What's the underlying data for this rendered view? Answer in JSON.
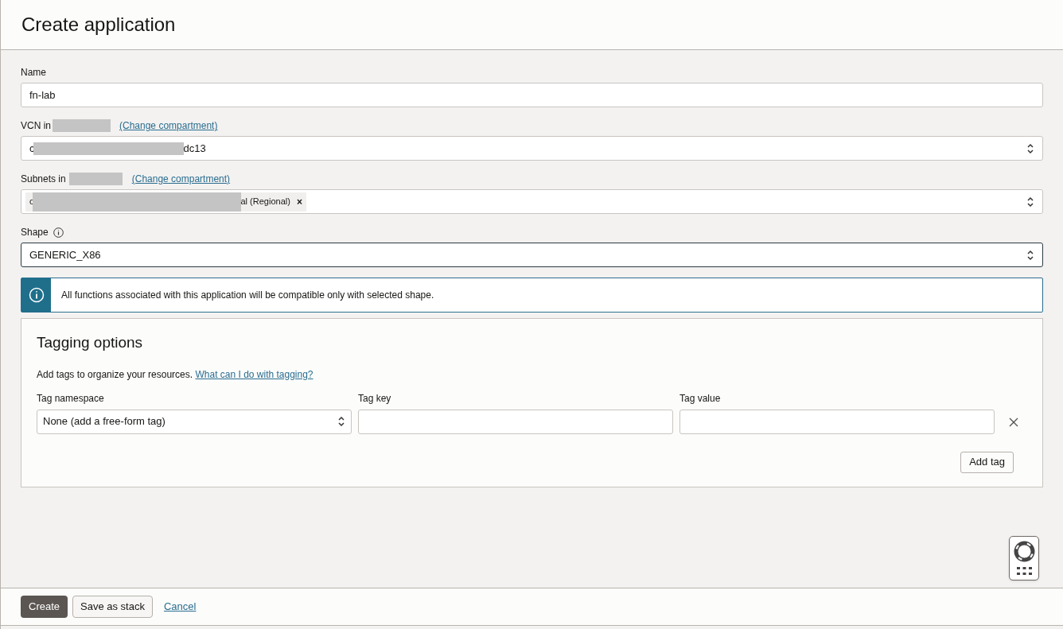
{
  "title": "Create application",
  "name_field": {
    "label": "Name",
    "value": "fn-lab"
  },
  "vcn_field": {
    "label": "VCN in",
    "link": "(Change compartment)",
    "value_start": "c",
    "value_end": "dc13",
    "redacted": true
  },
  "subnets_field": {
    "label": "Subnets in",
    "link": "(Change compartment)",
    "chip_start": "c",
    "chip_end": "al (Regional)",
    "chip_remove": "×",
    "redacted": true
  },
  "shape_field": {
    "label": "Shape",
    "value": "GENERIC_X86",
    "focused": true
  },
  "info_banner": {
    "text": "All functions associated with this application will be compatible only with selected shape."
  },
  "tagging": {
    "title": "Tagging options",
    "description": "Add tags to organize your resources.",
    "link": "What can I do with tagging?",
    "columns": [
      "Tag namespace",
      "Tag key",
      "Tag value"
    ],
    "namespace_value": "None (add a free-form tag)",
    "add_button": "Add tag"
  },
  "footer": {
    "buttons": [
      {
        "label": "Create",
        "kind": "primary"
      },
      {
        "label": "Save as stack",
        "kind": "secondary"
      },
      {
        "label": "Cancel",
        "kind": "link"
      }
    ]
  }
}
